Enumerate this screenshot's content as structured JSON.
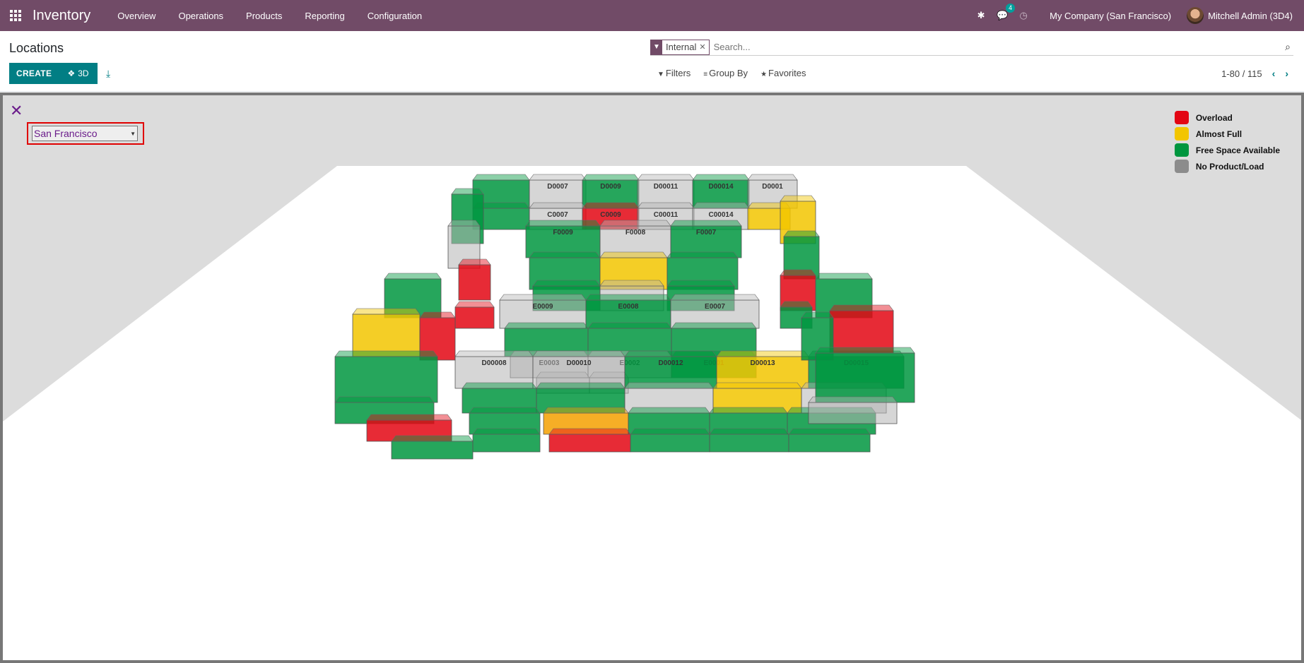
{
  "navbar": {
    "app_name": "Inventory",
    "menu": [
      "Overview",
      "Operations",
      "Products",
      "Reporting",
      "Configuration"
    ],
    "messages_count": "4",
    "company": "My Company (San Francisco)",
    "user": "Mitchell Admin (3D4)"
  },
  "control": {
    "title": "Locations",
    "create_label": "CREATE",
    "view_3d_label": "3D",
    "facet_label": "Internal",
    "search_placeholder": "Search...",
    "filters_label": "Filters",
    "groupby_label": "Group By",
    "favorites_label": "Favorites",
    "pager": "1-80 / 115"
  },
  "viewer": {
    "warehouse": "San Francisco",
    "legend": [
      {
        "label": "Overload",
        "color": "#e30613"
      },
      {
        "label": "Almost Full",
        "color": "#f2c500"
      },
      {
        "label": "Free Space Available",
        "color": "#00963f"
      },
      {
        "label": "No Product/Load",
        "color": "#8c8c8c"
      }
    ],
    "boxes": [
      {
        "label": "D0007"
      },
      {
        "label": "D0009"
      },
      {
        "label": "D00011"
      },
      {
        "label": "D00014"
      },
      {
        "label": "D0001"
      },
      {
        "label": "C0007"
      },
      {
        "label": "C0009"
      },
      {
        "label": "C00011"
      },
      {
        "label": "C00014"
      },
      {
        "label": "F0009"
      },
      {
        "label": "F0008"
      },
      {
        "label": "F0007"
      },
      {
        "label": "E0003"
      },
      {
        "label": "E0002"
      },
      {
        "label": "E0001"
      },
      {
        "label": "E0009"
      },
      {
        "label": "E0008"
      },
      {
        "label": "E0007"
      },
      {
        "label": "D00008"
      },
      {
        "label": "D00010"
      },
      {
        "label": "D00012"
      },
      {
        "label": "D00013"
      },
      {
        "label": "D00015"
      }
    ]
  }
}
